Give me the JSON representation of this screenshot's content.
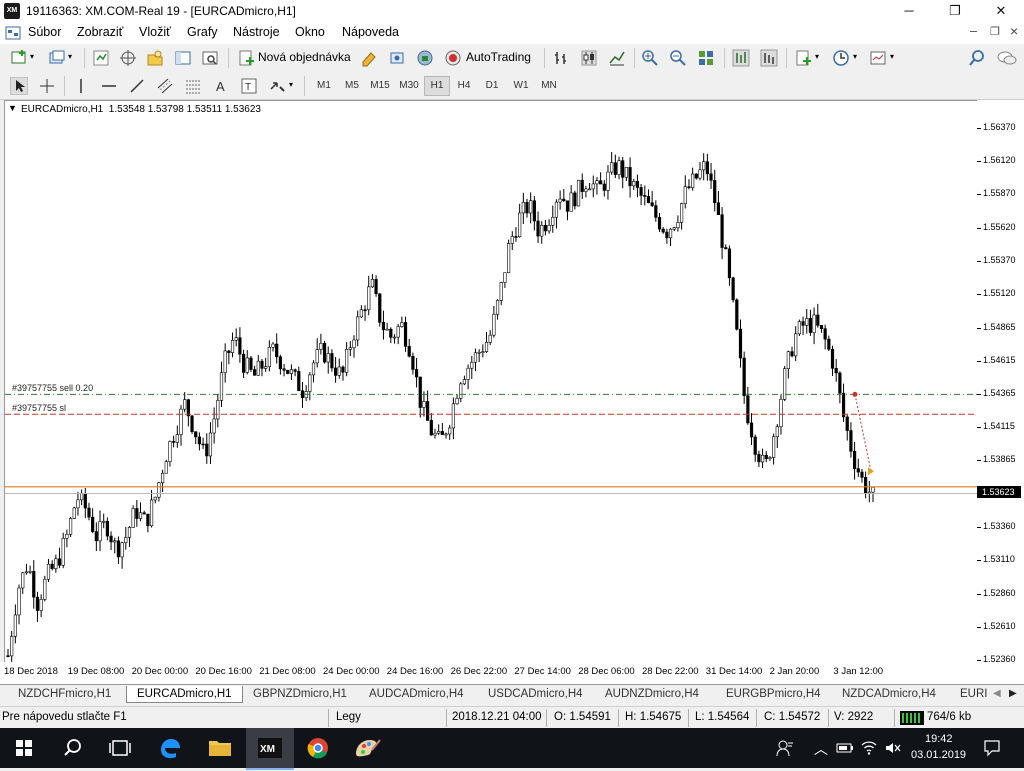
{
  "window": {
    "title": "19116363: XM.COM-Real 19 - [EURCADmicro,H1]",
    "app_badge": "XM",
    "minimize": "─",
    "maximize": "❐",
    "close": "✕"
  },
  "menu": [
    "Súbor",
    "Zobraziť",
    "Vložiť",
    "Grafy",
    "Nástroje",
    "Okno",
    "Nápoveda"
  ],
  "menu_right": {
    "minimize": "–",
    "restore": "❐",
    "close": "×"
  },
  "toolbar": {
    "new_order": "Nová objednávka",
    "autotrading": "AutoTrading"
  },
  "timeframes": [
    {
      "label": "M1",
      "active": false
    },
    {
      "label": "M5",
      "active": false
    },
    {
      "label": "M15",
      "active": false
    },
    {
      "label": "M30",
      "active": false
    },
    {
      "label": "H1",
      "active": true
    },
    {
      "label": "H4",
      "active": false
    },
    {
      "label": "D1",
      "active": false
    },
    {
      "label": "W1",
      "active": false
    },
    {
      "label": "MN",
      "active": false
    }
  ],
  "chart": {
    "header": "EURCADmicro,H1  1.53548 1.53798 1.53511 1.53623",
    "price_ticks": [
      "1.56370",
      "1.56120",
      "1.55870",
      "1.55620",
      "1.55370",
      "1.55120",
      "1.54865",
      "1.54615",
      "1.54365",
      "1.54115",
      "1.53865",
      "1.53623",
      "1.53360",
      "1.53110",
      "1.52860",
      "1.52610",
      "1.52360"
    ],
    "current_price": "1.53623",
    "order_line_label": "#39757755 sell 0.20",
    "sl_line_label": "#39757755 sl",
    "order_price": 1.5437,
    "sl_price": 1.5422,
    "time_ticks": [
      "18 Dec 2018",
      "19 Dec 08:00",
      "20 Dec 00:00",
      "20 Dec 16:00",
      "21 Dec 08:00",
      "24 Dec 00:00",
      "24 Dec 16:00",
      "26 Dec 22:00",
      "27 Dec 14:00",
      "28 Dec 06:00",
      "28 Dec 22:00",
      "31 Dec 14:00",
      "2 Jan 20:00",
      "3 Jan 12:00"
    ],
    "colors": {
      "order": "#2e7d32",
      "sl": "#c0392b",
      "current": "#e07a1f",
      "candle": "#000000"
    }
  },
  "chart_data": {
    "type": "candlestick",
    "symbol": "EURCADmicro",
    "timeframe": "H1",
    "last_bar": {
      "open": 1.53548,
      "high": 1.53798,
      "low": 1.53511,
      "close": 1.53623
    },
    "ylim": [
      1.5236,
      1.5637
    ],
    "close_path": [
      1.524,
      1.529,
      1.531,
      1.528,
      1.53,
      1.531,
      1.533,
      1.536,
      1.535,
      1.533,
      1.534,
      1.532,
      1.533,
      1.535,
      1.534,
      1.536,
      1.539,
      1.541,
      1.543,
      1.541,
      1.539,
      1.542,
      1.546,
      1.548,
      1.546,
      1.545,
      1.546,
      1.547,
      1.546,
      1.545,
      1.544,
      1.546,
      1.547,
      1.546,
      1.545,
      1.548,
      1.55,
      1.552,
      1.549,
      1.548,
      1.549,
      1.547,
      1.543,
      1.541,
      1.54,
      1.542,
      1.545,
      1.546,
      1.547,
      1.548,
      1.551,
      1.555,
      1.557,
      1.558,
      1.556,
      1.557,
      1.559,
      1.558,
      1.559,
      1.56,
      1.559,
      1.56,
      1.561,
      1.56,
      1.559,
      1.558,
      1.557,
      1.556,
      1.557,
      1.559,
      1.56,
      1.561,
      1.558,
      1.554,
      1.549,
      1.543,
      1.54,
      1.538,
      1.541,
      1.545,
      1.548,
      1.549,
      1.549,
      1.548,
      1.546,
      1.542,
      1.539,
      1.537,
      1.536
    ]
  },
  "tabs": [
    {
      "label": "NZDCHFmicro,H1",
      "active": false
    },
    {
      "label": "EURCADmicro,H1",
      "active": true
    },
    {
      "label": "GBPNZDmicro,H1",
      "active": false
    },
    {
      "label": "AUDCADmicro,H4",
      "active": false
    },
    {
      "label": "USDCADmicro,H4",
      "active": false
    },
    {
      "label": "AUDNZDmicro,H4",
      "active": false
    },
    {
      "label": "EURGBPmicro,H4",
      "active": false
    },
    {
      "label": "NZDCADmicro,H4",
      "active": false
    },
    {
      "label": "EURI",
      "active": false
    }
  ],
  "status": {
    "help": "Pre nápovedu stlačte F1",
    "profile": "Legy",
    "datetime": "2018.12.21 04:00",
    "open": "O: 1.54591",
    "high": "H: 1.54675",
    "low": "L: 1.54564",
    "close": "C: 1.54572",
    "volume": "V: 2922",
    "traffic": "764/6 kb"
  },
  "taskbar": {
    "time": "19:42",
    "date": "03.01.2019"
  }
}
